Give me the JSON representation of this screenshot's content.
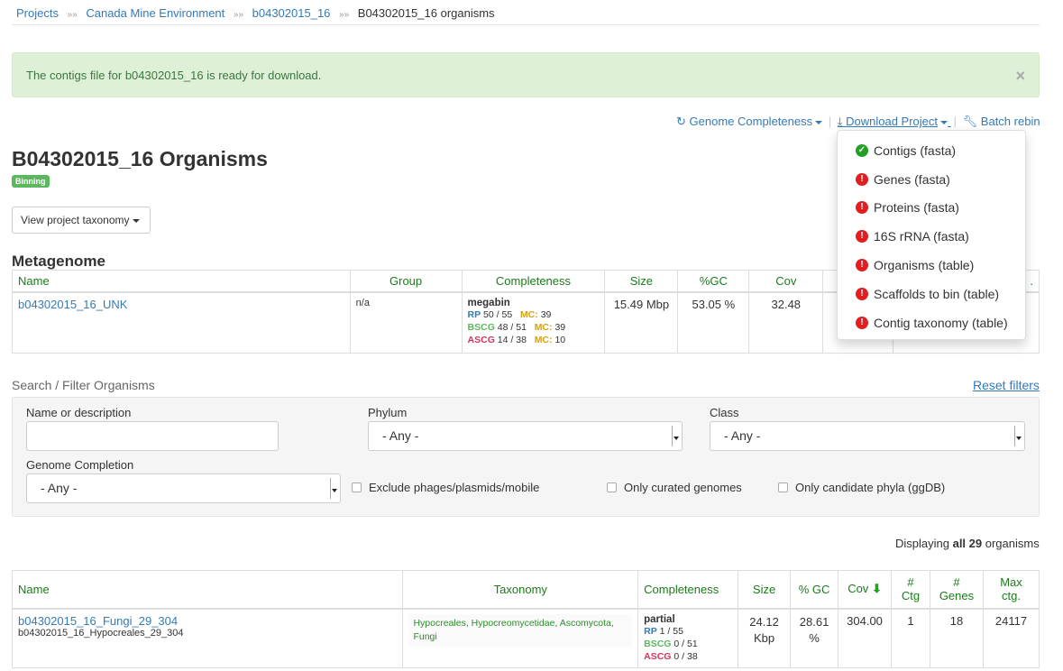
{
  "breadcrumb": {
    "items": [
      "Projects",
      "Canada Mine Environment",
      "b04302015_16"
    ],
    "separator": "»»",
    "current": "B04302015_16 organisms"
  },
  "alert": {
    "message": "The contigs file for b04302015_16 is ready for download.",
    "close": "×"
  },
  "toolbar": {
    "genome_completeness": "Genome Completeness",
    "download_project": "Download Project",
    "batch_rebin": "Batch rebin",
    "separator": "|"
  },
  "download_menu": [
    {
      "label": "Contigs (fasta)",
      "status": "ok"
    },
    {
      "label": "Genes (fasta)",
      "status": "error"
    },
    {
      "label": "Proteins (fasta)",
      "status": "error"
    },
    {
      "label": "16S rRNA (fasta)",
      "status": "error"
    },
    {
      "label": "Organisms (table)",
      "status": "error"
    },
    {
      "label": "Scaffolds to bin (table)",
      "status": "error"
    },
    {
      "label": "Contig taxonomy (table)",
      "status": "error"
    }
  ],
  "page": {
    "title": "B04302015_16 Organisms",
    "badge": "Binning",
    "taxonomy_button": "View project taxonomy"
  },
  "metagenome": {
    "section_title": "Metagenome",
    "headers": [
      "Name",
      "Group",
      "Completeness",
      "Size",
      "%GC",
      "Cov",
      "#",
      "."
    ],
    "row": {
      "name": "b04302015_16_UNK",
      "group": "n/a",
      "completeness_title": "megabin",
      "rp": "RP",
      "rp_val": "50 / 55",
      "bscg": "BSCG",
      "bscg_val": "48 / 51",
      "ascg": "ASCG",
      "ascg_val": "14 / 38",
      "mc": "MC:",
      "rp_mc": "39",
      "bscg_mc": "39",
      "ascg_mc": "10",
      "size": "15.49 Mbp",
      "gc": "53.05 %",
      "cov": "32.48"
    }
  },
  "filter": {
    "title": "Search / Filter Organisms",
    "reset": "Reset filters",
    "name_label": "Name or description",
    "name_value": "",
    "phylum_label": "Phylum",
    "phylum_value": "- Any -",
    "class_label": "Class",
    "class_value": "- Any -",
    "completion_label": "Genome Completion",
    "completion_value": "- Any -",
    "checkboxes": [
      "Exclude phages/plasmids/mobile",
      "Only curated genomes",
      "Only candidate phyla (ggDB)"
    ]
  },
  "displaying": {
    "prefix": "Displaying ",
    "bold": "all 29",
    "suffix": " organisms"
  },
  "organisms": {
    "headers": {
      "name": "Name",
      "taxonomy": "Taxonomy",
      "completeness": "Completeness",
      "size": "Size",
      "gc": "% GC",
      "cov": "Cov",
      "cov_sort": "⬇",
      "ctg_hash": "#",
      "ctg": "Ctg",
      "genes_hash": "#",
      "genes": "Genes",
      "max": "Max",
      "max2": "ctg."
    },
    "rows": [
      {
        "name": "b04302015_16_Fungi_29_304",
        "subname": "b04302015_16_Hypocreales_29_304",
        "taxonomy": "Hypocreales, Hypocreomycetidae, Ascomycota, Fungi",
        "completeness_title": "partial",
        "rp": "RP",
        "rp_val": "1 / 55",
        "bscg": "BSCG",
        "bscg_val": "0 / 51",
        "ascg": "ASCG",
        "ascg_val": "0 / 38",
        "size": "24.12",
        "size_unit": "Kbp",
        "gc": "28.61",
        "gc_unit": "%",
        "cov": "304.00",
        "ctg": "1",
        "genes": "18",
        "max_ctg": "24117"
      }
    ]
  },
  "colors": {
    "link": "#337ab7",
    "header_green": "#1a7c1a",
    "alert_bg": "#dff0d8",
    "badge_green": "#5cb85c",
    "error_red": "#e02020"
  }
}
